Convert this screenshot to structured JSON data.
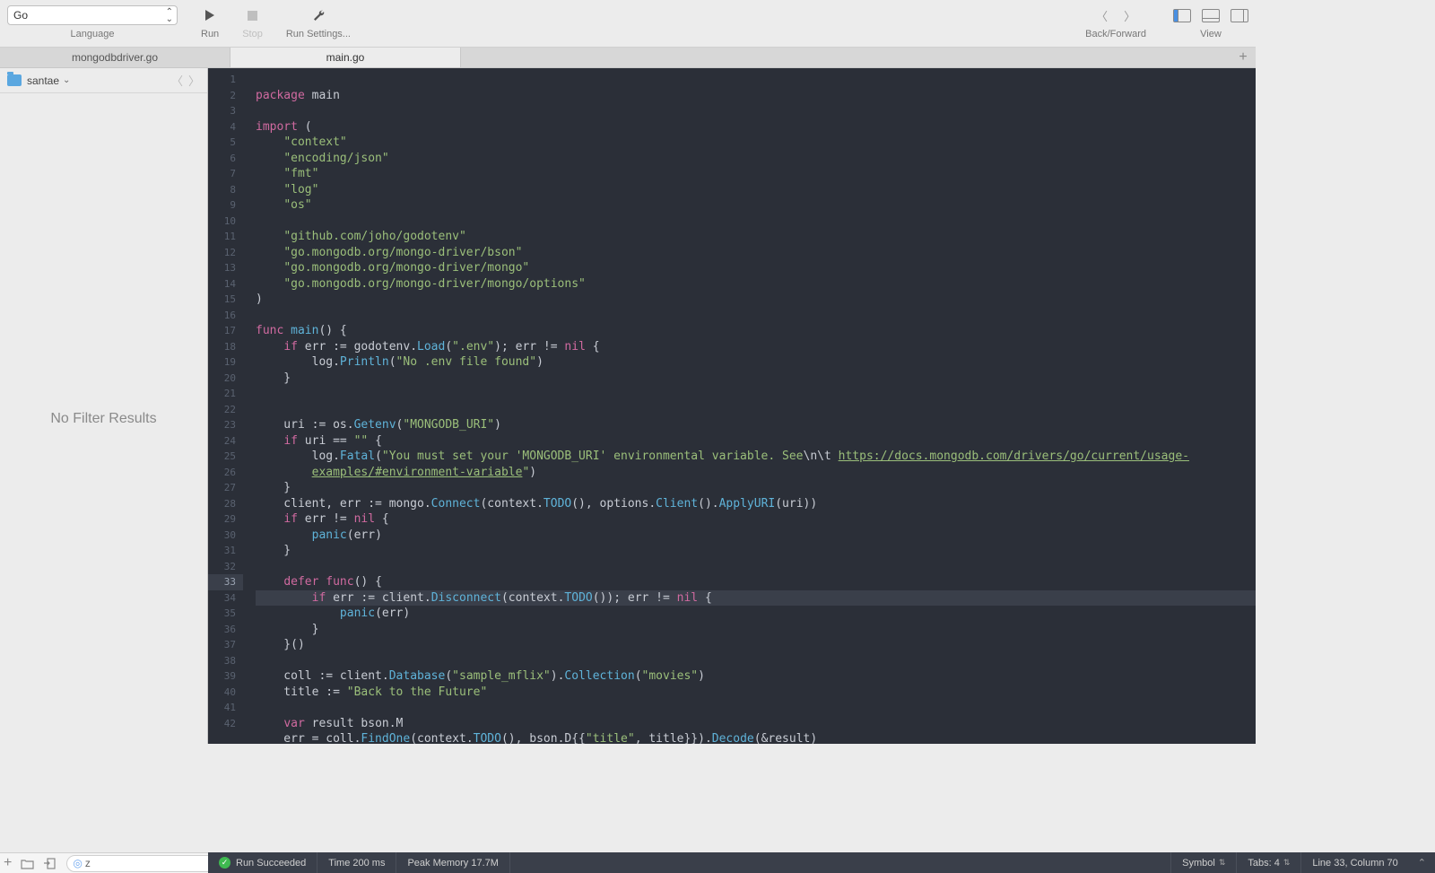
{
  "toolbar": {
    "language_value": "Go",
    "language_label": "Language",
    "run_label": "Run",
    "stop_label": "Stop",
    "settings_label": "Run Settings...",
    "backforward": "Back/Forward",
    "view_label": "View"
  },
  "tabs": [
    {
      "label": "mongodbdriver.go",
      "active": false
    },
    {
      "label": "main.go",
      "active": true
    }
  ],
  "crumb": {
    "label": "santae"
  },
  "sidebar_empty": "No Filter Results",
  "bottom_left": {
    "filter_value": "z"
  },
  "status": {
    "run": "Run Succeeded",
    "time": "Time 200 ms",
    "mem": "Peak Memory 17.7M",
    "symbol": "Symbol",
    "tabs": "Tabs: 4",
    "pos": "Line 33, Column 70"
  },
  "code_lines": [
    {
      "n": 1,
      "t": []
    },
    {
      "n": 2,
      "t": [
        {
          "c": "kw",
          "s": "package"
        },
        {
          "c": "id",
          "s": " main"
        }
      ]
    },
    {
      "n": 3,
      "t": []
    },
    {
      "n": 4,
      "t": [
        {
          "c": "kw",
          "s": "import"
        },
        {
          "c": "id",
          "s": " ("
        }
      ]
    },
    {
      "n": 5,
      "t": [
        {
          "c": "id",
          "s": "    "
        },
        {
          "c": "str",
          "s": "\"context\""
        }
      ]
    },
    {
      "n": 6,
      "t": [
        {
          "c": "id",
          "s": "    "
        },
        {
          "c": "str",
          "s": "\"encoding/json\""
        }
      ]
    },
    {
      "n": 7,
      "t": [
        {
          "c": "id",
          "s": "    "
        },
        {
          "c": "str",
          "s": "\"fmt\""
        }
      ]
    },
    {
      "n": 8,
      "t": [
        {
          "c": "id",
          "s": "    "
        },
        {
          "c": "str",
          "s": "\"log\""
        }
      ]
    },
    {
      "n": 9,
      "t": [
        {
          "c": "id",
          "s": "    "
        },
        {
          "c": "str",
          "s": "\"os\""
        }
      ]
    },
    {
      "n": 10,
      "t": []
    },
    {
      "n": 11,
      "t": [
        {
          "c": "id",
          "s": "    "
        },
        {
          "c": "str",
          "s": "\"github.com/joho/godotenv\""
        }
      ]
    },
    {
      "n": 12,
      "t": [
        {
          "c": "id",
          "s": "    "
        },
        {
          "c": "str",
          "s": "\"go.mongodb.org/mongo-driver/bson\""
        }
      ]
    },
    {
      "n": 13,
      "t": [
        {
          "c": "id",
          "s": "    "
        },
        {
          "c": "str",
          "s": "\"go.mongodb.org/mongo-driver/mongo\""
        }
      ]
    },
    {
      "n": 14,
      "t": [
        {
          "c": "id",
          "s": "    "
        },
        {
          "c": "str",
          "s": "\"go.mongodb.org/mongo-driver/mongo/options\""
        }
      ]
    },
    {
      "n": 15,
      "t": [
        {
          "c": "id",
          "s": ")"
        }
      ]
    },
    {
      "n": 16,
      "t": []
    },
    {
      "n": 17,
      "t": [
        {
          "c": "kw",
          "s": "func"
        },
        {
          "c": "id",
          "s": " "
        },
        {
          "c": "fn",
          "s": "main"
        },
        {
          "c": "id",
          "s": "() {"
        }
      ]
    },
    {
      "n": 18,
      "t": [
        {
          "c": "id",
          "s": "    "
        },
        {
          "c": "kw",
          "s": "if"
        },
        {
          "c": "id",
          "s": " err := godotenv."
        },
        {
          "c": "fn",
          "s": "Load"
        },
        {
          "c": "id",
          "s": "("
        },
        {
          "c": "str",
          "s": "\".env\""
        },
        {
          "c": "id",
          "s": "); err != "
        },
        {
          "c": "lit",
          "s": "nil"
        },
        {
          "c": "id",
          "s": " {"
        }
      ]
    },
    {
      "n": 19,
      "t": [
        {
          "c": "id",
          "s": "        log."
        },
        {
          "c": "fn",
          "s": "Println"
        },
        {
          "c": "id",
          "s": "("
        },
        {
          "c": "str",
          "s": "\"No .env file found\""
        },
        {
          "c": "id",
          "s": ")"
        }
      ]
    },
    {
      "n": 20,
      "t": [
        {
          "c": "id",
          "s": "    }"
        }
      ]
    },
    {
      "n": 21,
      "t": []
    },
    {
      "n": 22,
      "t": []
    },
    {
      "n": 23,
      "t": [
        {
          "c": "id",
          "s": "    uri := os."
        },
        {
          "c": "fn",
          "s": "Getenv"
        },
        {
          "c": "id",
          "s": "("
        },
        {
          "c": "str",
          "s": "\"MONGODB_URI\""
        },
        {
          "c": "id",
          "s": ")"
        }
      ]
    },
    {
      "n": 24,
      "t": [
        {
          "c": "id",
          "s": "    "
        },
        {
          "c": "kw",
          "s": "if"
        },
        {
          "c": "id",
          "s": " uri == "
        },
        {
          "c": "str",
          "s": "\"\""
        },
        {
          "c": "id",
          "s": " {"
        }
      ]
    },
    {
      "n": 25,
      "t": [
        {
          "c": "id",
          "s": "        log."
        },
        {
          "c": "fn",
          "s": "Fatal"
        },
        {
          "c": "id",
          "s": "("
        },
        {
          "c": "str",
          "s": "\"You must set your 'MONGODB_URI' environmental variable. See"
        },
        {
          "c": "id",
          "s": "\\n\\t "
        },
        {
          "c": "lnk",
          "s": "https://docs.mongodb.com/drivers/go/current/usage-"
        }
      ]
    },
    {
      "n": "",
      "t": [
        {
          "c": "id",
          "s": "        "
        },
        {
          "c": "lnk",
          "s": "examples/#environment-variable"
        },
        {
          "c": "str",
          "s": "\""
        },
        {
          "c": "id",
          "s": ")"
        }
      ]
    },
    {
      "n": 26,
      "t": [
        {
          "c": "id",
          "s": "    }"
        }
      ]
    },
    {
      "n": 27,
      "t": [
        {
          "c": "id",
          "s": "    client, err := mongo."
        },
        {
          "c": "fn",
          "s": "Connect"
        },
        {
          "c": "id",
          "s": "(context."
        },
        {
          "c": "fn",
          "s": "TODO"
        },
        {
          "c": "id",
          "s": "(), options."
        },
        {
          "c": "fn",
          "s": "Client"
        },
        {
          "c": "id",
          "s": "()."
        },
        {
          "c": "fn",
          "s": "ApplyURI"
        },
        {
          "c": "id",
          "s": "(uri))"
        }
      ]
    },
    {
      "n": 28,
      "t": [
        {
          "c": "id",
          "s": "    "
        },
        {
          "c": "kw",
          "s": "if"
        },
        {
          "c": "id",
          "s": " err != "
        },
        {
          "c": "lit",
          "s": "nil"
        },
        {
          "c": "id",
          "s": " {"
        }
      ]
    },
    {
      "n": 29,
      "t": [
        {
          "c": "id",
          "s": "        "
        },
        {
          "c": "fn",
          "s": "panic"
        },
        {
          "c": "id",
          "s": "(err)"
        }
      ]
    },
    {
      "n": 30,
      "t": [
        {
          "c": "id",
          "s": "    }"
        }
      ]
    },
    {
      "n": 31,
      "t": []
    },
    {
      "n": 32,
      "t": [
        {
          "c": "id",
          "s": "    "
        },
        {
          "c": "kw",
          "s": "defer"
        },
        {
          "c": "id",
          "s": " "
        },
        {
          "c": "kw",
          "s": "func"
        },
        {
          "c": "id",
          "s": "() {"
        }
      ]
    },
    {
      "n": 33,
      "hl": true,
      "t": [
        {
          "c": "id",
          "s": "        "
        },
        {
          "c": "kw",
          "s": "if"
        },
        {
          "c": "id",
          "s": " err := client."
        },
        {
          "c": "fn",
          "s": "Disconnect"
        },
        {
          "c": "id",
          "s": "(context."
        },
        {
          "c": "fn",
          "s": "TODO"
        },
        {
          "c": "id",
          "s": "()); err != "
        },
        {
          "c": "lit",
          "s": "nil"
        },
        {
          "c": "id",
          "s": " {"
        }
      ]
    },
    {
      "n": 34,
      "t": [
        {
          "c": "id",
          "s": "            "
        },
        {
          "c": "fn",
          "s": "panic"
        },
        {
          "c": "id",
          "s": "(err)"
        }
      ]
    },
    {
      "n": 35,
      "t": [
        {
          "c": "id",
          "s": "        }"
        }
      ]
    },
    {
      "n": 36,
      "t": [
        {
          "c": "id",
          "s": "    }()"
        }
      ]
    },
    {
      "n": 37,
      "t": []
    },
    {
      "n": 38,
      "t": [
        {
          "c": "id",
          "s": "    coll := client."
        },
        {
          "c": "fn",
          "s": "Database"
        },
        {
          "c": "id",
          "s": "("
        },
        {
          "c": "str",
          "s": "\"sample_mflix\""
        },
        {
          "c": "id",
          "s": ")."
        },
        {
          "c": "fn",
          "s": "Collection"
        },
        {
          "c": "id",
          "s": "("
        },
        {
          "c": "str",
          "s": "\"movies\""
        },
        {
          "c": "id",
          "s": ")"
        }
      ]
    },
    {
      "n": 39,
      "t": [
        {
          "c": "id",
          "s": "    title := "
        },
        {
          "c": "str",
          "s": "\"Back to the Future\""
        }
      ]
    },
    {
      "n": 40,
      "t": []
    },
    {
      "n": 41,
      "t": [
        {
          "c": "id",
          "s": "    "
        },
        {
          "c": "kw",
          "s": "var"
        },
        {
          "c": "id",
          "s": " result bson.M"
        }
      ]
    },
    {
      "n": 42,
      "t": [
        {
          "c": "id",
          "s": "    err = coll."
        },
        {
          "c": "fn",
          "s": "FindOne"
        },
        {
          "c": "id",
          "s": "(context."
        },
        {
          "c": "fn",
          "s": "TODO"
        },
        {
          "c": "id",
          "s": "(), bson.D{{"
        },
        {
          "c": "str",
          "s": "\"title\""
        },
        {
          "c": "id",
          "s": ", title}})."
        },
        {
          "c": "fn",
          "s": "Decode"
        },
        {
          "c": "id",
          "s": "(&result)"
        }
      ]
    }
  ]
}
